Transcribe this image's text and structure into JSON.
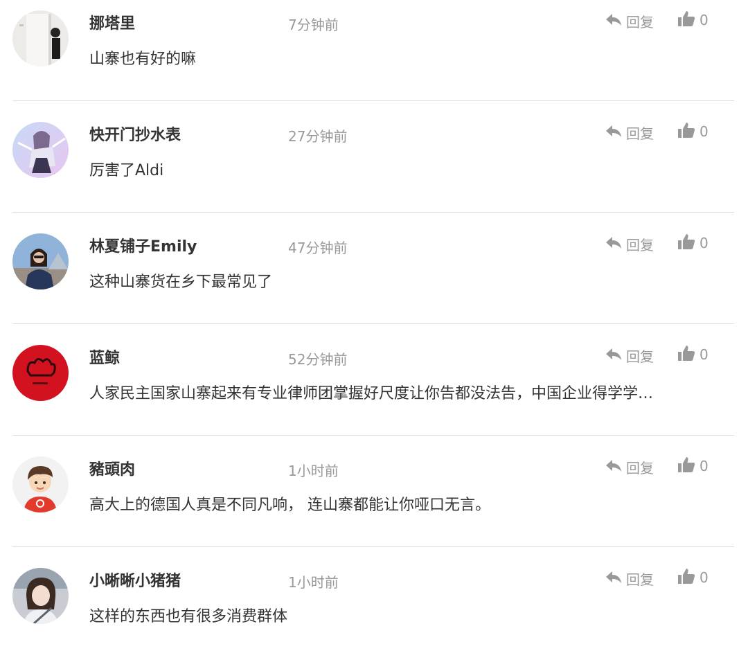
{
  "comments": [
    {
      "username": "挪塔里",
      "time": "7分钟前",
      "text": "山寨也有好的嘛",
      "reply_label": "回复",
      "likes": "0",
      "avatar_icon": "photo-woman-doorway-avatar"
    },
    {
      "username": "快开门抄水表",
      "time": "27分钟前",
      "text": "厉害了Aldi",
      "reply_label": "回复",
      "likes": "0",
      "avatar_icon": "anime-girl-avatar"
    },
    {
      "username": "林夏铺子Emily",
      "time": "47分钟前",
      "text": "这种山寨货在乡下最常见了",
      "reply_label": "回复",
      "likes": "0",
      "avatar_icon": "photo-woman-louvre-avatar"
    },
    {
      "username": "蓝鲸",
      "time": "52分钟前",
      "text": "人家民主国家山寨起来有专业律师团掌握好尺度让你告都没法告，中国企业得学学…",
      "reply_label": "回复",
      "likes": "0",
      "avatar_icon": "red-logo-avatar"
    },
    {
      "username": "豬頭肉",
      "time": "1小时前",
      "text": "高大上的德国人真是不同凡响， 连山寨都能让你哑口无言。",
      "reply_label": "回复",
      "likes": "0",
      "avatar_icon": "cartoon-boy-avatar"
    },
    {
      "username": "小晰晰小猪猪",
      "time": "1小时前",
      "text": "这样的东西也有很多消费群体",
      "reply_label": "回复",
      "likes": "0",
      "avatar_icon": "photo-woman-car-avatar"
    }
  ],
  "colors": {
    "username": "#333333",
    "meta": "#999999",
    "divider": "#dddddd",
    "red_avatar": "#d3121f"
  }
}
